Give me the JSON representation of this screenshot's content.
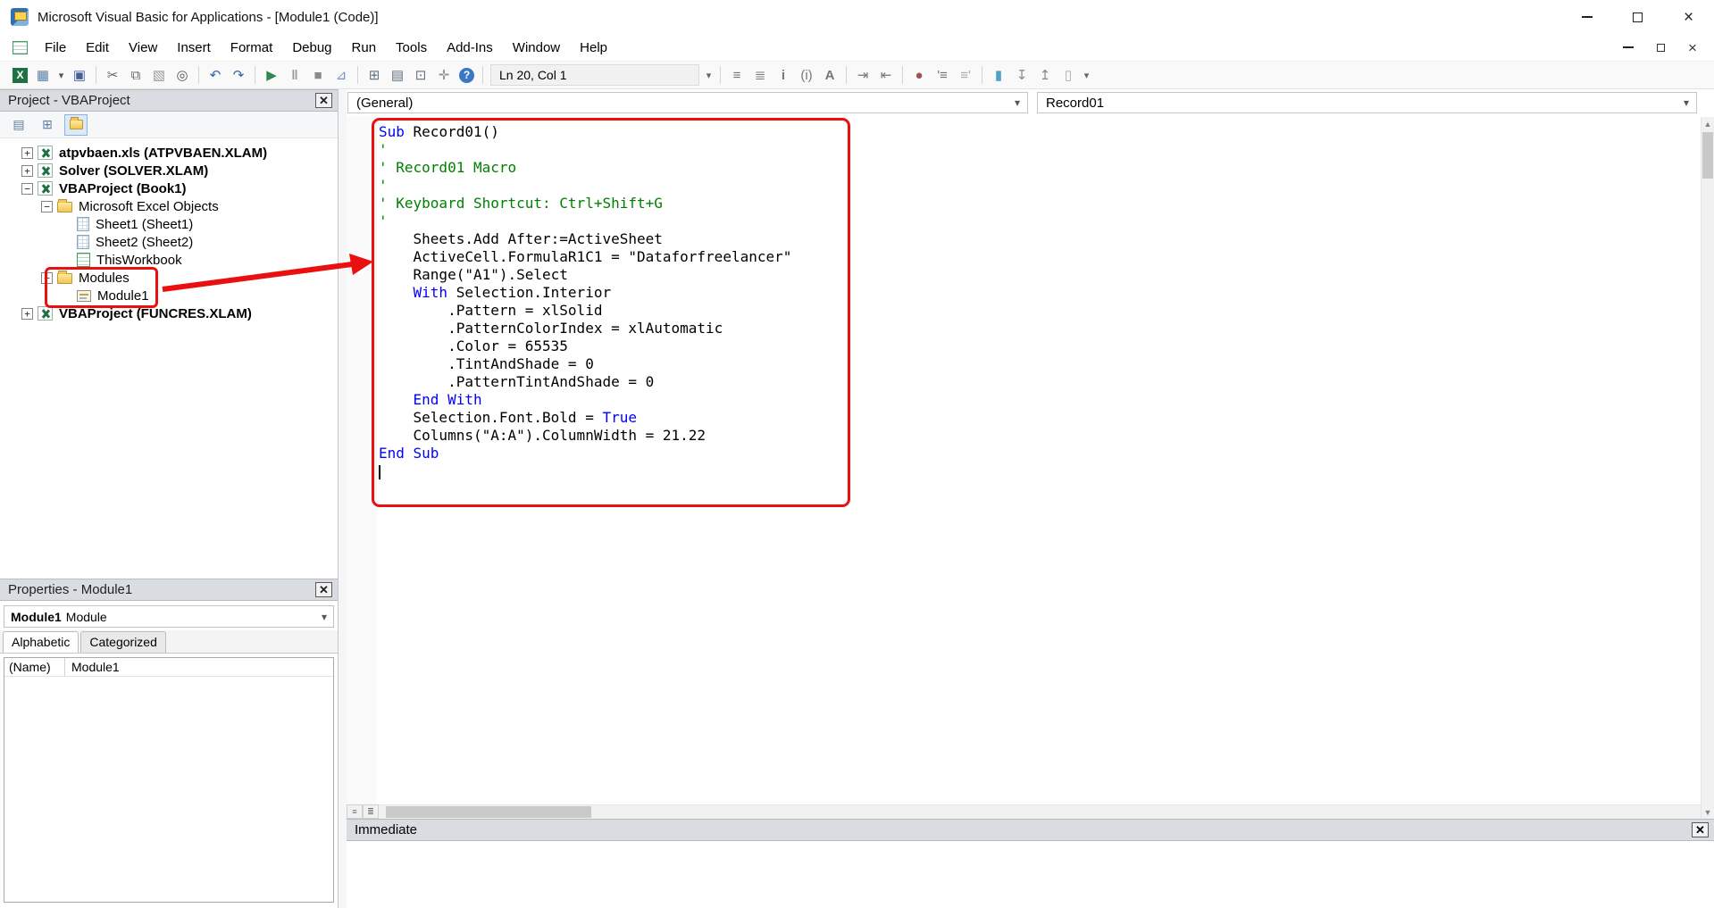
{
  "window": {
    "title": "Microsoft Visual Basic for Applications - [Module1 (Code)]"
  },
  "menu": {
    "items": [
      "File",
      "Edit",
      "View",
      "Insert",
      "Format",
      "Debug",
      "Run",
      "Tools",
      "Add-Ins",
      "Window",
      "Help"
    ]
  },
  "toolbar": {
    "position_indicator": "Ln 20, Col 1",
    "items": [
      {
        "n": "view-excel-icon",
        "g": "X",
        "c": "#ffffff",
        "bg": "#1e7145",
        "b": true
      },
      {
        "n": "insert-userform-icon",
        "g": "▦",
        "c": "#5a7fae"
      },
      {
        "n": "insert-userform-dropdown-icon",
        "g": "▾",
        "c": "#555555",
        "narrow": true
      },
      {
        "n": "save-icon",
        "g": "▣",
        "c": "#44609a"
      },
      {
        "sep": true
      },
      {
        "n": "cut-icon",
        "g": "✂",
        "c": "#666666"
      },
      {
        "n": "copy-icon",
        "g": "⧉",
        "c": "#666666"
      },
      {
        "n": "paste-icon",
        "g": "▧",
        "c": "#999999"
      },
      {
        "n": "find-icon",
        "g": "◎",
        "c": "#555555"
      },
      {
        "sep": true
      },
      {
        "n": "undo-icon",
        "g": "↶",
        "c": "#3565a8"
      },
      {
        "n": "redo-icon",
        "g": "↷",
        "c": "#3565a8"
      },
      {
        "sep": true
      },
      {
        "n": "run-icon",
        "g": "▶",
        "c": "#2d8a4e"
      },
      {
        "n": "break-icon",
        "g": "‖",
        "c": "#9a9a9a",
        "b": true
      },
      {
        "n": "reset-icon",
        "g": "■",
        "c": "#8a8a8a"
      },
      {
        "n": "design-mode-icon",
        "g": "⊿",
        "c": "#7a93b8"
      },
      {
        "sep": true
      },
      {
        "n": "project-explorer-icon",
        "g": "⊞",
        "c": "#5f6f80"
      },
      {
        "n": "properties-window-icon",
        "g": "▤",
        "c": "#5f6f80"
      },
      {
        "n": "object-browser-icon",
        "g": "⊡",
        "c": "#5f6f80"
      },
      {
        "n": "toolbox-icon",
        "g": "✛",
        "c": "#8a8a8a"
      },
      {
        "n": "help-icon",
        "g": "?",
        "c": "#ffffff",
        "bg": "#3b78c3",
        "round": true,
        "b": true
      },
      {
        "sep": true
      },
      {
        "ln": true
      },
      {
        "n": "toolbar-options-icon",
        "g": "▾",
        "c": "#666666",
        "narrow": true
      },
      {
        "sep": true
      },
      {
        "n": "list-properties-icon",
        "g": "≡",
        "c": "#777777"
      },
      {
        "n": "list-constants-icon",
        "g": "≣",
        "c": "#777777"
      },
      {
        "n": "quick-info-icon",
        "g": "i",
        "c": "#777777",
        "b": true
      },
      {
        "n": "parameter-info-icon",
        "g": "(i)",
        "c": "#777777"
      },
      {
        "n": "complete-word-icon",
        "g": "A",
        "c": "#777777",
        "b": true
      },
      {
        "sep": true
      },
      {
        "n": "indent-icon",
        "g": "⇥",
        "c": "#777777"
      },
      {
        "n": "outdent-icon",
        "g": "⇤",
        "c": "#777777"
      },
      {
        "sep": true
      },
      {
        "n": "toggle-breakpoint-icon",
        "g": "●",
        "c": "#a05050"
      },
      {
        "n": "comment-block-icon",
        "g": "'≡",
        "c": "#777777"
      },
      {
        "n": "uncomment-block-icon",
        "g": "≡'",
        "c": "#aaaaaa"
      },
      {
        "sep": true
      },
      {
        "n": "toggle-bookmark-icon",
        "g": "▮",
        "c": "#4fa3c8"
      },
      {
        "n": "next-bookmark-icon",
        "g": "↧",
        "c": "#888888"
      },
      {
        "n": "previous-bookmark-icon",
        "g": "↥",
        "c": "#888888"
      },
      {
        "n": "clear-bookmarks-icon",
        "g": "▯",
        "c": "#aaaaaa"
      },
      {
        "n": "edit-toolbar-options-icon",
        "g": "▾",
        "c": "#666666",
        "narrow": true
      }
    ]
  },
  "project_panel": {
    "title": "Project - VBAProject",
    "tree": [
      {
        "level": 0,
        "expand": "+",
        "icon": "excel-project",
        "label": "atpvbaen.xls (ATPVBAEN.XLAM)",
        "bold": true
      },
      {
        "level": 0,
        "expand": "+",
        "icon": "excel-project",
        "label": "Solver (SOLVER.XLAM)",
        "bold": true
      },
      {
        "level": 0,
        "expand": "−",
        "icon": "excel-project",
        "label": "VBAProject (Book1)",
        "bold": true
      },
      {
        "level": 1,
        "expand": "−",
        "icon": "folder",
        "label": "Microsoft Excel Objects",
        "bold": false
      },
      {
        "level": 2,
        "expand": null,
        "icon": "sheet",
        "label": "Sheet1 (Sheet1)",
        "bold": false
      },
      {
        "level": 2,
        "expand": null,
        "icon": "sheet",
        "label": "Sheet2 (Sheet2)",
        "bold": false
      },
      {
        "level": 2,
        "expand": null,
        "icon": "workbook",
        "label": "ThisWorkbook",
        "bold": false
      },
      {
        "level": 1,
        "expand": "−",
        "icon": "folder",
        "label": "Modules",
        "bold": false
      },
      {
        "level": 2,
        "expand": null,
        "icon": "module",
        "label": "Module1",
        "bold": false
      },
      {
        "level": 0,
        "expand": "+",
        "icon": "excel-project",
        "label": "VBAProject (FUNCRES.XLAM)",
        "bold": true
      }
    ]
  },
  "code_window": {
    "object_dropdown": "(General)",
    "procedure_dropdown": "Record01",
    "lines": [
      [
        [
          "k",
          "Sub"
        ],
        [
          "t",
          " Record01()"
        ]
      ],
      [
        [
          "c",
          "'"
        ]
      ],
      [
        [
          "c",
          "' Record01 Macro"
        ]
      ],
      [
        [
          "c",
          "'"
        ]
      ],
      [
        [
          "c",
          "' Keyboard Shortcut: Ctrl+Shift+G"
        ]
      ],
      [
        [
          "c",
          "'"
        ]
      ],
      [
        [
          "t",
          "    Sheets.Add After:=ActiveSheet"
        ]
      ],
      [
        [
          "t",
          "    ActiveCell.FormulaR1C1 = \"Dataforfreelancer\""
        ]
      ],
      [
        [
          "t",
          "    Range(\"A1\").Select"
        ]
      ],
      [
        [
          "t",
          "    "
        ],
        [
          "k",
          "With"
        ],
        [
          "t",
          " Selection.Interior"
        ]
      ],
      [
        [
          "t",
          "        .Pattern = xlSolid"
        ]
      ],
      [
        [
          "t",
          "        .PatternColorIndex = xlAutomatic"
        ]
      ],
      [
        [
          "t",
          "        .Color = 65535"
        ]
      ],
      [
        [
          "t",
          "        .TintAndShade = 0"
        ]
      ],
      [
        [
          "t",
          "        .PatternTintAndShade = 0"
        ]
      ],
      [
        [
          "t",
          "    "
        ],
        [
          "k",
          "End With"
        ]
      ],
      [
        [
          "t",
          "    Selection.Font.Bold = "
        ],
        [
          "k",
          "True"
        ]
      ],
      [
        [
          "t",
          "    Columns(\"A:A\").ColumnWidth = 21.22"
        ]
      ],
      [
        [
          "k",
          "End Sub"
        ]
      ],
      [
        [
          "x",
          ""
        ]
      ]
    ]
  },
  "properties_panel": {
    "title": "Properties - Module1",
    "selected_object": {
      "name": "Module1",
      "type": "Module"
    },
    "tabs": [
      "Alphabetic",
      "Categorized"
    ],
    "active_tab": 0,
    "rows": [
      {
        "name": "(Name)",
        "value": "Module1"
      }
    ]
  },
  "immediate_panel": {
    "title": "Immediate"
  },
  "colors": {
    "keyword": "#0000ff",
    "comment": "#008000",
    "code_text": "#000000",
    "annotation": "#ea1010"
  }
}
